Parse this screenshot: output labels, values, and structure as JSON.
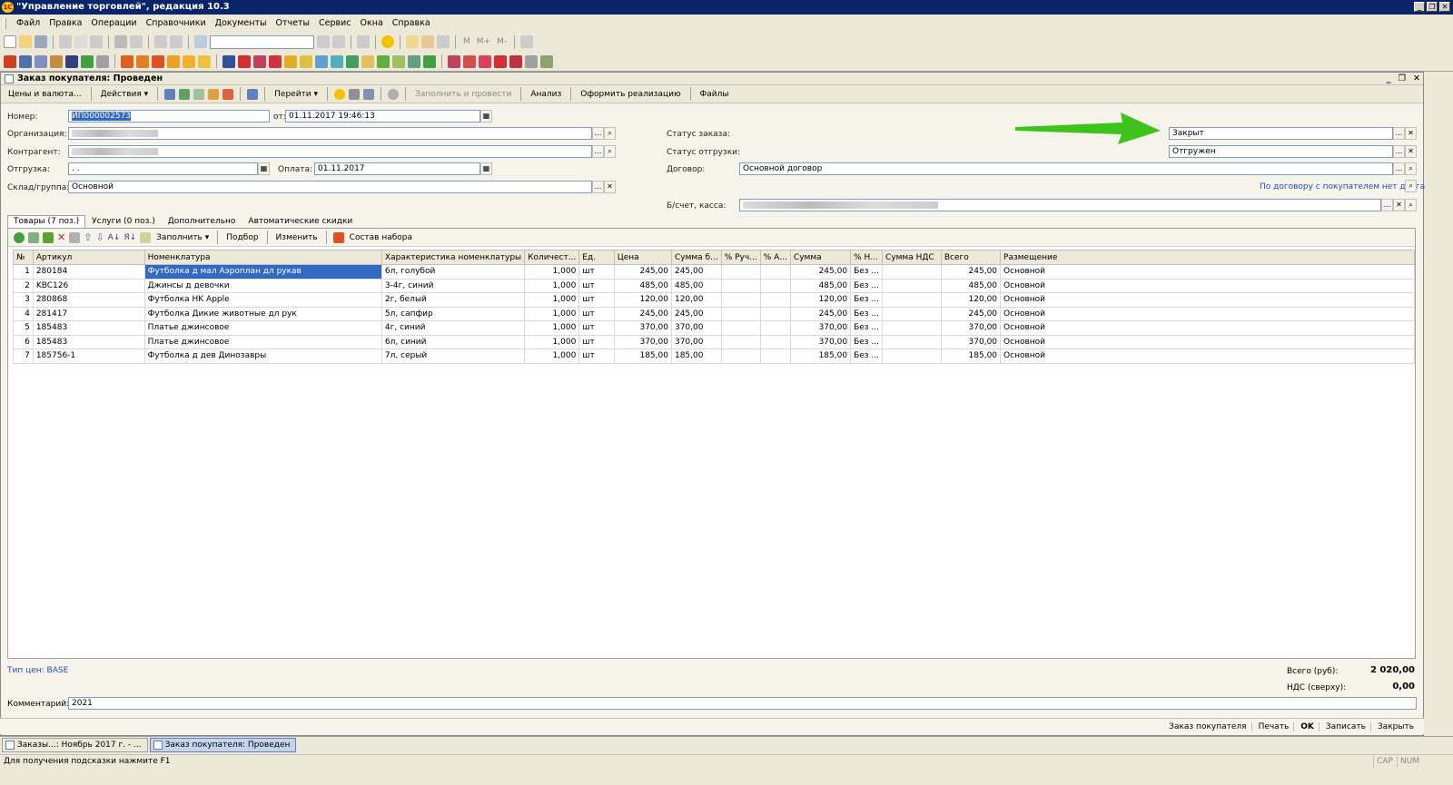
{
  "window": {
    "title": "\"Управление торговлей\", редакция 10.3",
    "app_icon": "1C"
  },
  "menu": [
    "Файл",
    "Правка",
    "Операции",
    "Справочники",
    "Документы",
    "Отчеты",
    "Сервис",
    "Окна",
    "Справка"
  ],
  "toolbar": {
    "text_buttons": [
      "M",
      "M+",
      "M-"
    ]
  },
  "document": {
    "title": "Заказ покупателя: Проведен",
    "toolbar": {
      "prices": "Цены и валюта...",
      "actions": "Действия",
      "goto": "Перейти",
      "fill_post": "Заполнить и провести",
      "analysis": "Анализ",
      "make_sale": "Оформить реализацию",
      "files": "Файлы"
    },
    "fields": {
      "number_label": "Номер:",
      "number_value": "ИП000002573",
      "from_label": "от:",
      "from_value": "01.11.2017 19:46:13",
      "org_label": "Организация:",
      "contractor_label": "Контрагент:",
      "shipment_label": "Отгрузка:",
      "shipment_value": ". .",
      "payment_label": "Оплата:",
      "payment_value": "01.11.2017",
      "warehouse_label": "Склад/группа:",
      "warehouse_value": "Основной",
      "order_status_label": "Статус заказа:",
      "order_status_value": "Закрыт",
      "ship_status_label": "Статус отгрузки:",
      "ship_status_value": "Отгружен",
      "contract_label": "Договор:",
      "contract_value": "Основной договор",
      "debt_link": "По договору с покупателем нет долга",
      "account_label": "Б/счет, касса:"
    },
    "tabs": [
      "Товары (7 поз.)",
      "Услуги (0 поз.)",
      "Дополнительно",
      "Автоматические скидки"
    ],
    "table_toolbar": {
      "fill": "Заполнить",
      "pick": "Подбор",
      "change": "Изменить",
      "set": "Состав набора"
    },
    "columns": [
      "№",
      "Артикул",
      "Номенклатура",
      "Характеристика номенклатуры",
      "Количест...",
      "Ед.",
      "Цена",
      "Сумма б...",
      "% Руч...",
      "% А...",
      "Сумма",
      "% Н...",
      "Сумма НДС",
      "Всего",
      "Размещение"
    ],
    "rows": [
      [
        "1",
        "280184",
        "Футболка д мал Аэроплан дл рукав",
        "6л, голубой",
        "1,000",
        "шт",
        "245,00",
        "245,00",
        "",
        "",
        "245,00",
        "Без ...",
        "",
        "245,00",
        "Основной"
      ],
      [
        "2",
        "KBC126",
        "Джинсы д девочки",
        "3-4г, синий",
        "1,000",
        "шт",
        "485,00",
        "485,00",
        "",
        "",
        "485,00",
        "Без ...",
        "",
        "485,00",
        "Основной"
      ],
      [
        "3",
        "280868",
        "Футболка HK Apple",
        "2г, белый",
        "1,000",
        "шт",
        "120,00",
        "120,00",
        "",
        "",
        "120,00",
        "Без ...",
        "",
        "120,00",
        "Основной"
      ],
      [
        "4",
        "281417",
        "Футболка Дикие животные дл рук",
        "5л, сапфир",
        "1,000",
        "шт",
        "245,00",
        "245,00",
        "",
        "",
        "245,00",
        "Без ...",
        "",
        "245,00",
        "Основной"
      ],
      [
        "5",
        "185483",
        "Платье джинсовое",
        "4г, синий",
        "1,000",
        "шт",
        "370,00",
        "370,00",
        "",
        "",
        "370,00",
        "Без ...",
        "",
        "370,00",
        "Основной"
      ],
      [
        "6",
        "185483",
        "Платье джинсовое",
        "6л, синий",
        "1,000",
        "шт",
        "370,00",
        "370,00",
        "",
        "",
        "370,00",
        "Без ...",
        "",
        "370,00",
        "Основной"
      ],
      [
        "7",
        "185756-1",
        "Футболка д дев Динозавры",
        "7л, серый",
        "1,000",
        "шт",
        "185,00",
        "185,00",
        "",
        "",
        "185,00",
        "Без ...",
        "",
        "185,00",
        "Основной"
      ]
    ],
    "price_type": "Тип цен: BASE",
    "totals": {
      "total_label": "Всего (руб):",
      "total_value": "2 020,00",
      "vat_label": "НДС (сверху):",
      "vat_value": "0,00"
    },
    "comment_label": "Комментарий:",
    "comment_value": "2021",
    "bottom_buttons": [
      "Заказ покупателя",
      "Печать",
      "OK",
      "Записать",
      "Закрыть"
    ]
  },
  "taskbar": [
    "Заказы...: Ноябрь 2017 г. - ...",
    "Заказ покупателя: Проведен"
  ],
  "status": {
    "hint": "Для получения подсказки нажмите F1",
    "cap": "CAP",
    "num": "NUM"
  },
  "colors": {
    "title_bar": "#0a246a",
    "selection": "#316ac5",
    "link": "#1f4cc4",
    "arrow": "#3ec31a"
  }
}
